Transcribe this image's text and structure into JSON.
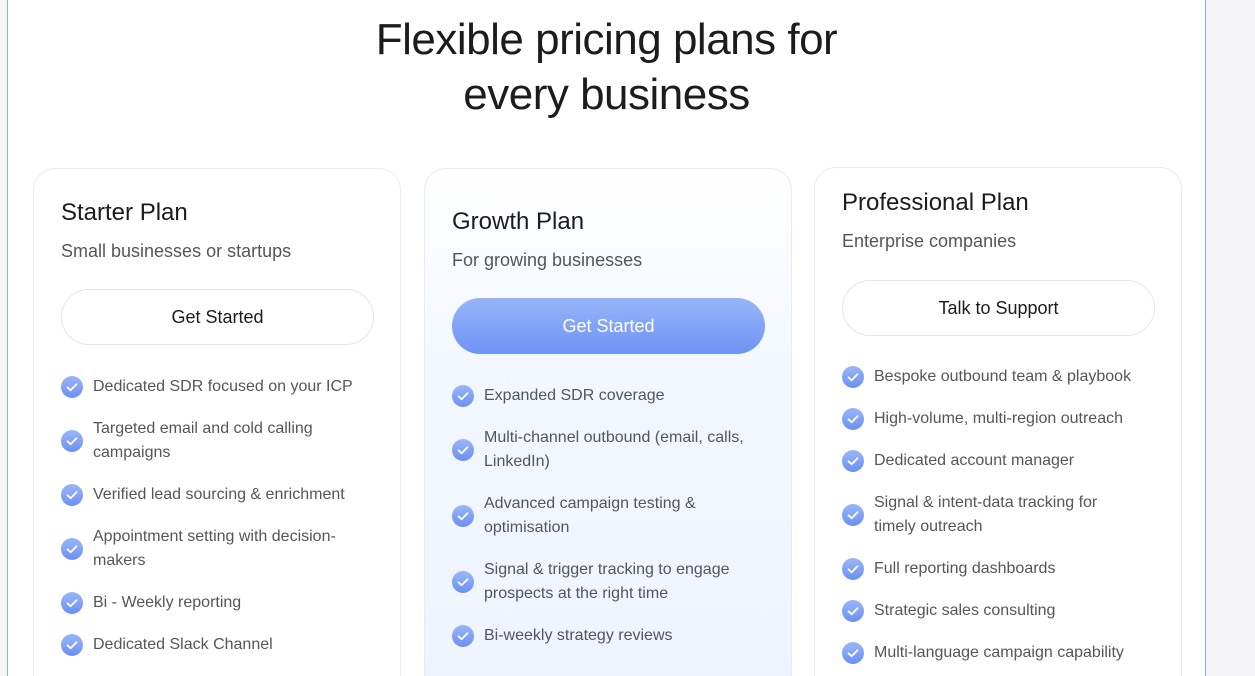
{
  "heading": {
    "line1": "Flexible pricing plans for",
    "line2": "every business"
  },
  "plans": [
    {
      "title": "Starter Plan",
      "subtitle": "Small businesses or startups",
      "button": "Get Started",
      "features": [
        "Dedicated SDR focused on your ICP",
        "Targeted email and cold calling campaigns",
        "Verified lead sourcing & enrichment",
        "Appointment setting with decision-makers",
        "Bi - Weekly reporting",
        "Dedicated Slack Channel"
      ]
    },
    {
      "title": "Growth Plan",
      "subtitle": "For growing businesses",
      "button": "Get Started",
      "features": [
        "Expanded SDR coverage",
        "Multi-channel outbound (email, calls, LinkedIn)",
        "Advanced campaign testing & optimisation",
        "Signal & trigger tracking to engage prospects at the right time",
        "Bi-weekly strategy reviews"
      ]
    },
    {
      "title": "Professional Plan",
      "subtitle": "Enterprise companies",
      "button": "Talk to Support",
      "features": [
        "Bespoke outbound team & playbook",
        "High-volume, multi-region outreach",
        "Dedicated account manager",
        "Signal & intent-data tracking for timely outreach",
        "Full reporting dashboards",
        "Strategic sales consulting",
        "Multi-language campaign capability"
      ]
    }
  ],
  "icons": {
    "feature": "check-circle-icon"
  },
  "colors": {
    "accent_top": "#97b5fa",
    "accent_bottom": "#6e93f4",
    "check": "#7b9df5"
  }
}
